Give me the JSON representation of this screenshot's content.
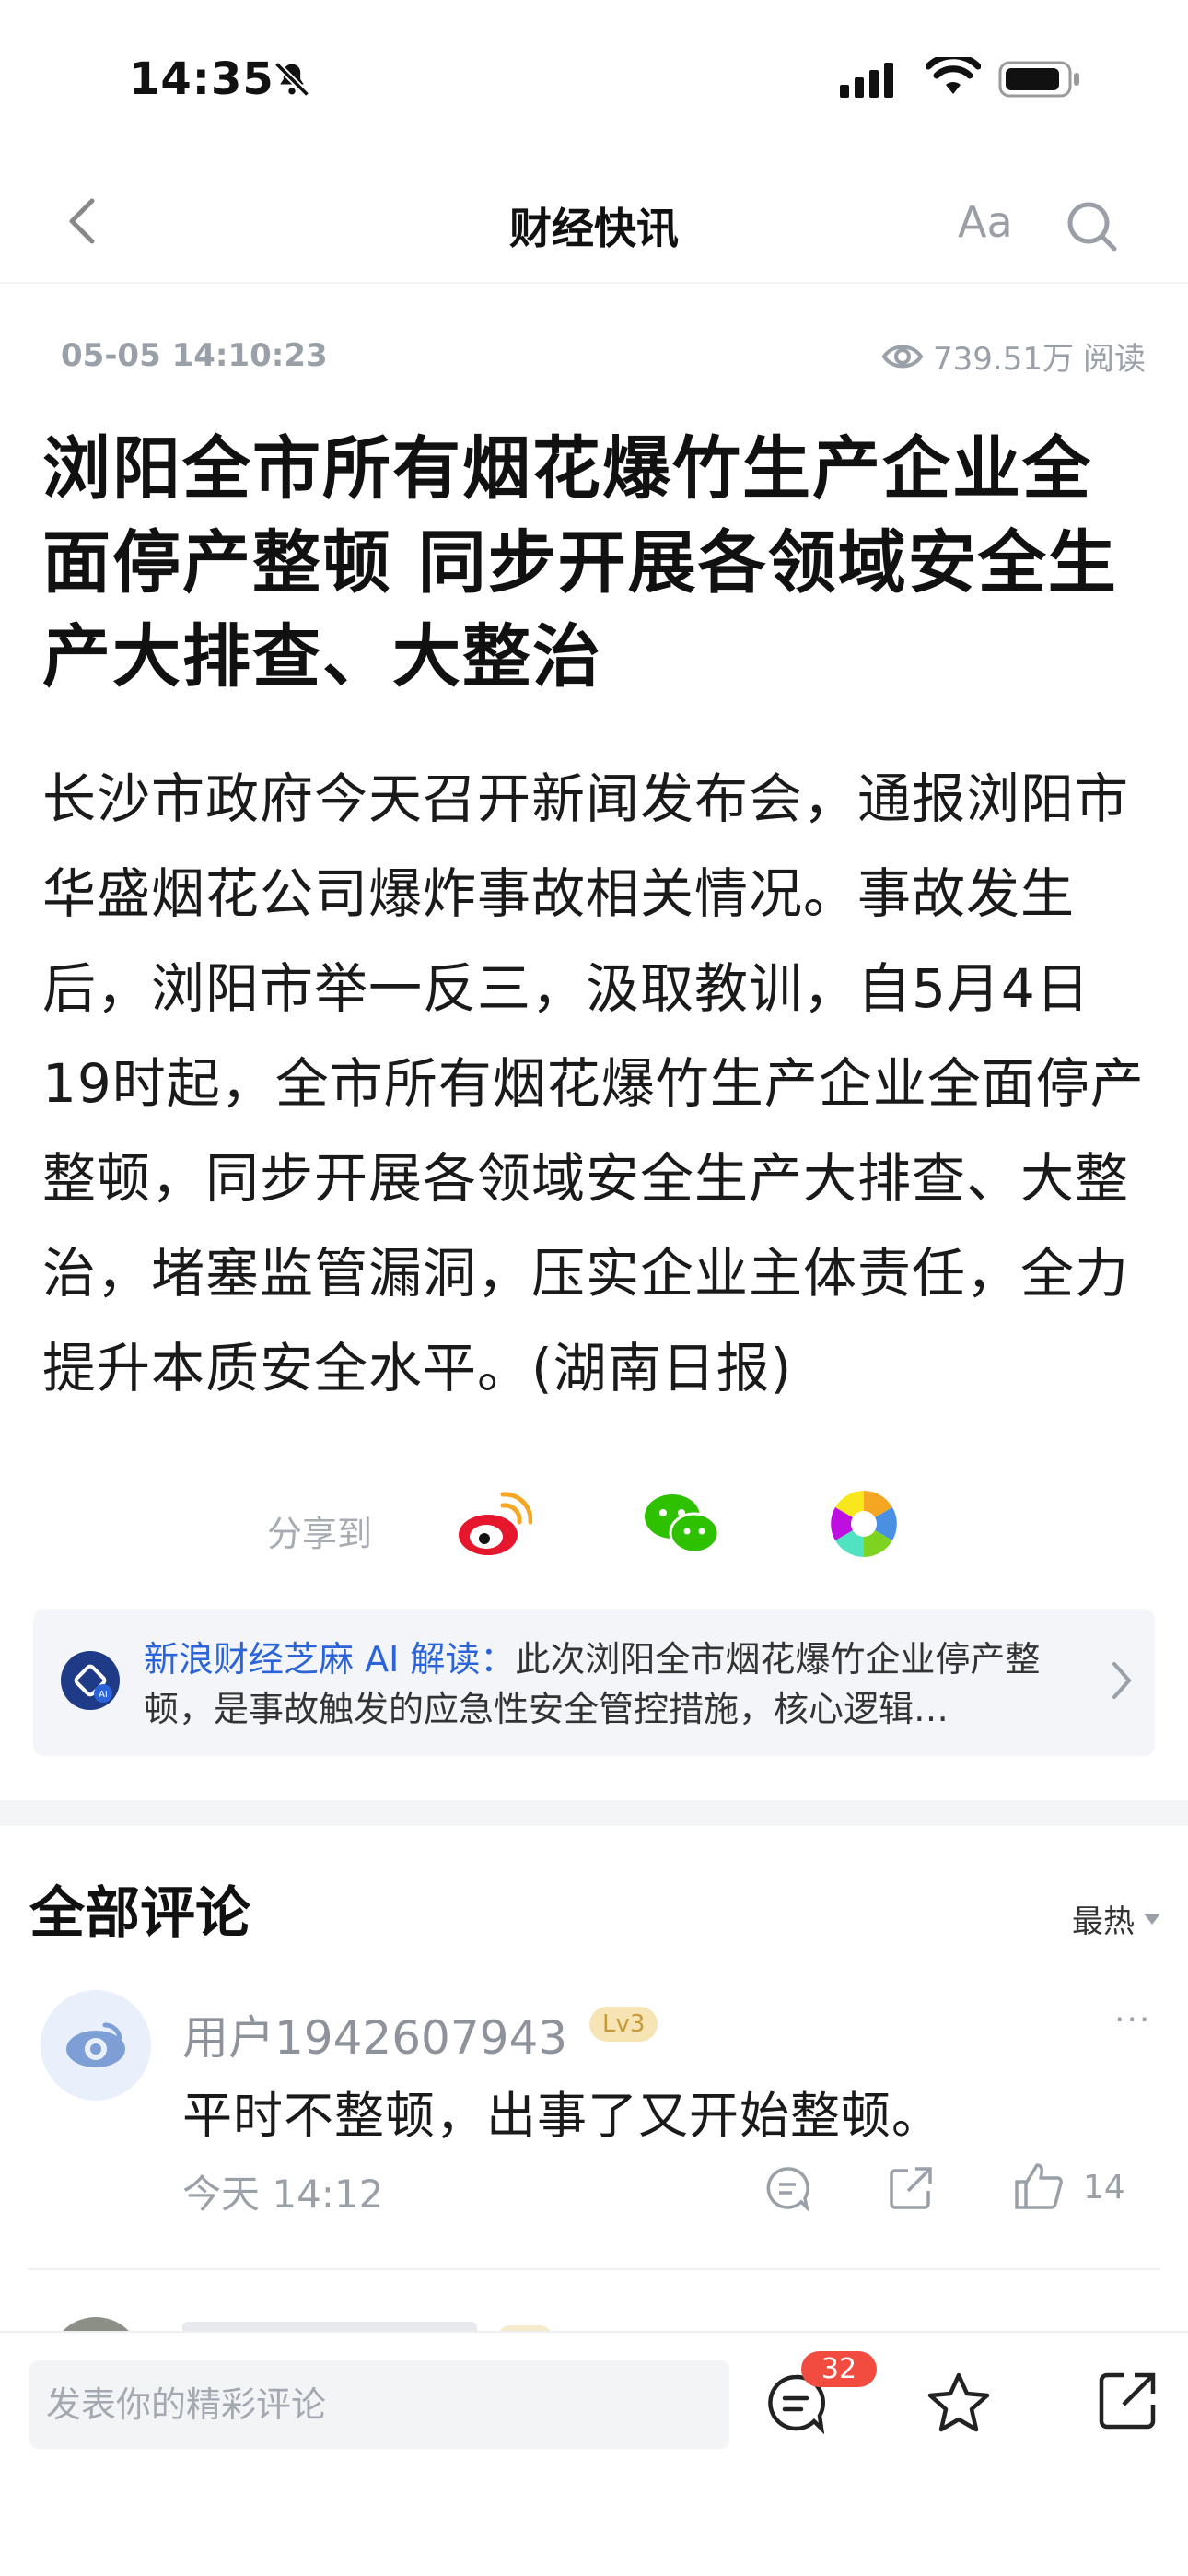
{
  "status_bar": {
    "time": "14:35"
  },
  "nav": {
    "title": "财经快讯",
    "font_size_label": "Aa"
  },
  "article": {
    "date": "05-05 14:10:23",
    "views_count": "739.51万",
    "views_label": "阅读",
    "title": "浏阳全市所有烟花爆竹生产企业全面停产整顿 同步开展各领域安全生产大排查、大整治",
    "body": "长沙市政府今天召开新闻发布会，通报浏阳市华盛烟花公司爆炸事故相关情况。事故发生后，浏阳市举一反三，汲取教训，自5月4日19时起，全市所有烟花爆竹生产企业全面停产整顿，同步开展各领域安全生产大排查、大整治，堵塞监管漏洞，压实企业主体责任，全力提升本质安全水平。(湖南日报)"
  },
  "share": {
    "label": "分享到"
  },
  "ai_card": {
    "prefix": "新浪财经芝麻 AI 解读：",
    "text": "此次浏阳全市烟花爆竹企业停产整顿，是事故触发的应急性安全管控措施，核心逻辑…"
  },
  "comments": {
    "heading": "全部评论",
    "sort": "最热",
    "items": [
      {
        "user": "用户1942607943",
        "level": "Lv3",
        "text": "平时不整顿，出事了又开始整顿。",
        "time": "今天 14:12",
        "likes": "14"
      }
    ]
  },
  "bottom_bar": {
    "input_placeholder": "发表你的精彩评论",
    "comment_count": "32"
  },
  "colors": {
    "accent_blue": "#2b64d8",
    "badge_red": "#f24c41",
    "level_gold": "#c79a36"
  }
}
